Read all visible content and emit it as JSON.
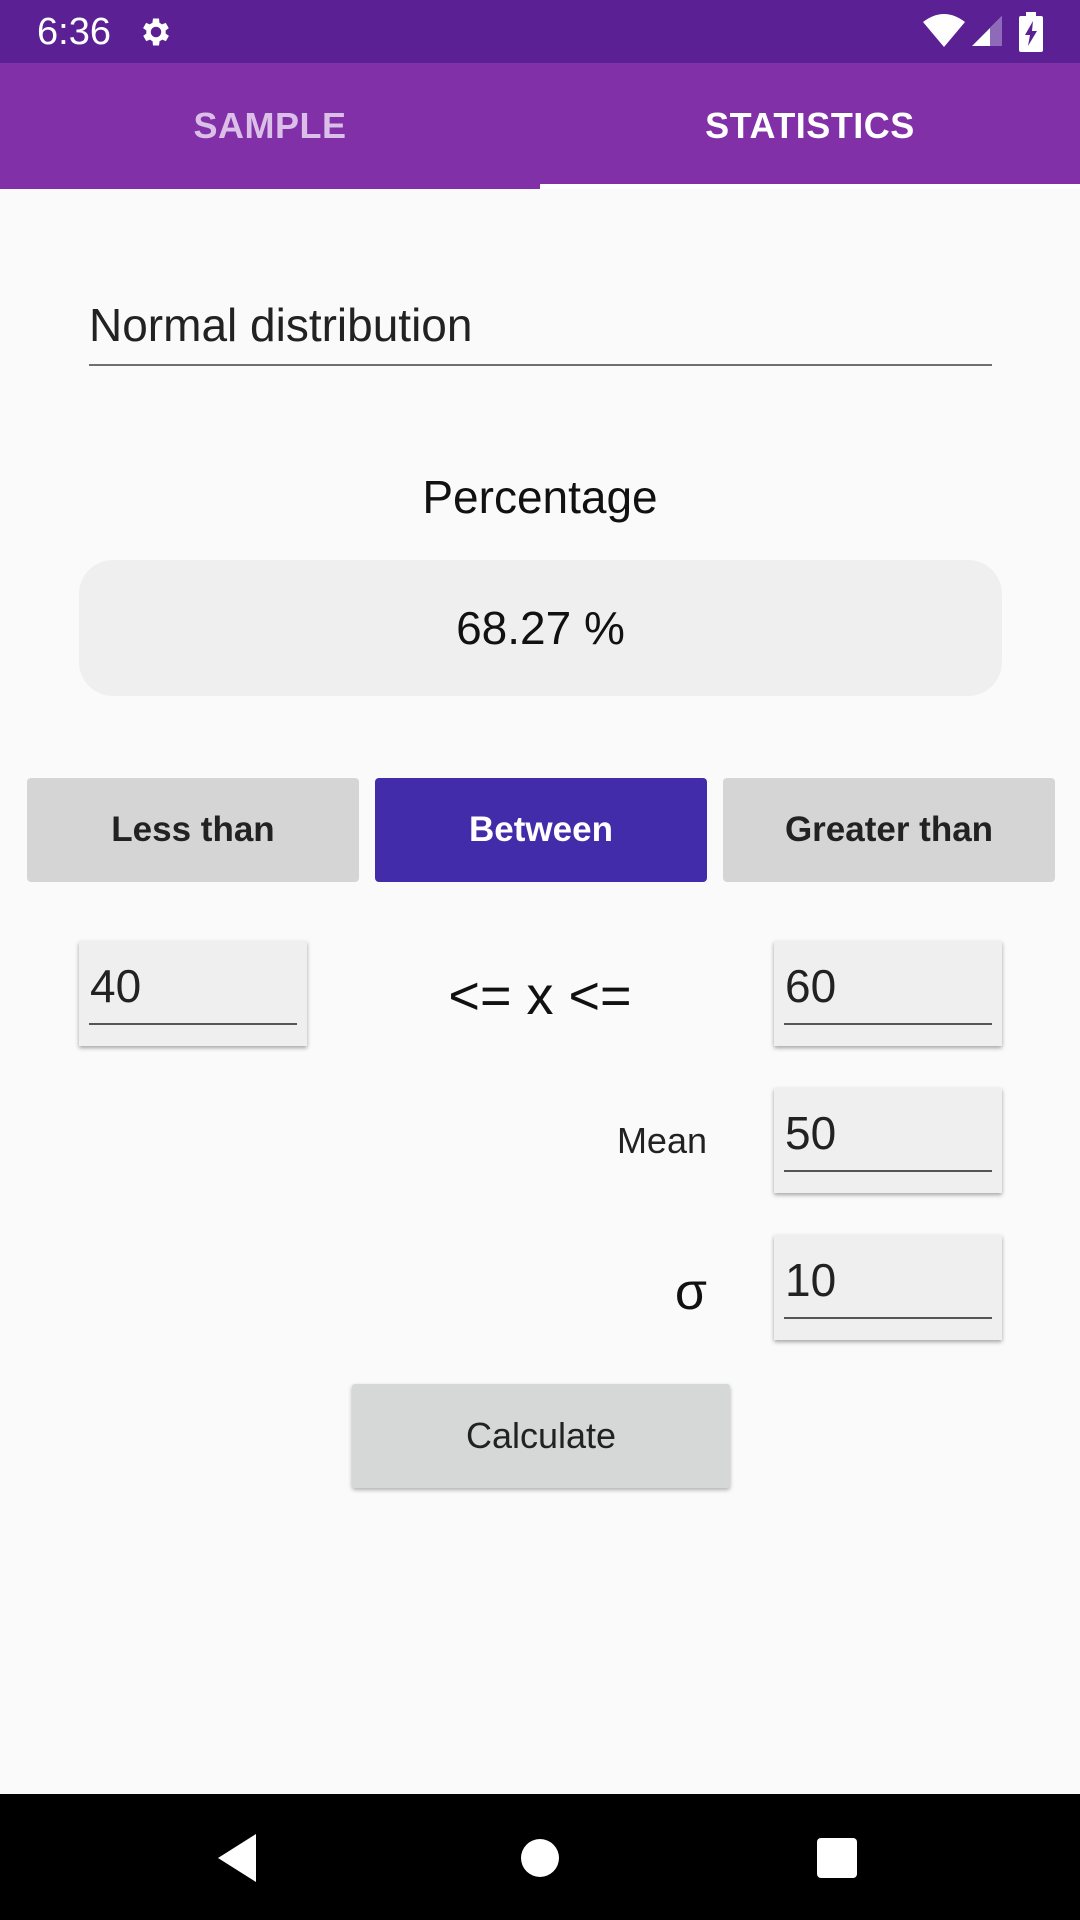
{
  "status_bar": {
    "time": "6:36",
    "icons": [
      "settings-gear-icon",
      "wifi-icon",
      "cellular-signal-icon",
      "battery-charging-icon"
    ]
  },
  "tabs": [
    {
      "label": "SAMPLE",
      "selected": false
    },
    {
      "label": "STATISTICS",
      "selected": true
    }
  ],
  "distribution": {
    "selected": "Normal distribution"
  },
  "result": {
    "label": "Percentage",
    "value": "68.27 %"
  },
  "modes": [
    {
      "label": "Less than",
      "selected": false
    },
    {
      "label": "Between",
      "selected": true
    },
    {
      "label": "Greater than",
      "selected": false
    }
  ],
  "range": {
    "lower": "40",
    "symbol": "<= x <=",
    "upper": "60"
  },
  "mean": {
    "label": "Mean",
    "value": "50"
  },
  "sigma": {
    "label": "σ",
    "value": "10"
  },
  "calculate_label": "Calculate",
  "nav": [
    "back-icon",
    "home-icon",
    "recents-icon"
  ],
  "colors": {
    "status_bar": "#5b2194",
    "tab_bar": "#8130a8",
    "accent_button": "#432ca9",
    "button_gray": "#d5d5d5"
  }
}
